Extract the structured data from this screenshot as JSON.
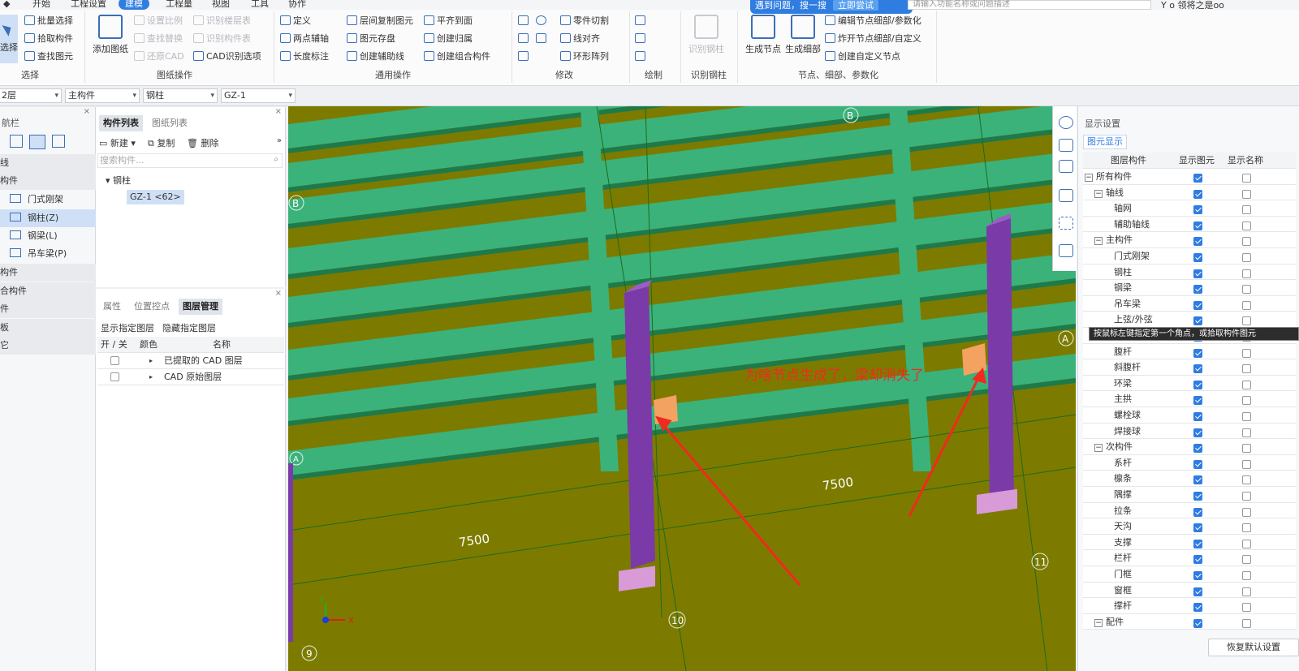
{
  "menu": {
    "tabs": [
      "开始",
      "工程设置",
      "建模",
      "工程量",
      "视图",
      "工具",
      "协作"
    ],
    "active_tab": "建模"
  },
  "notice": {
    "text": "遇到问题，搜一搜",
    "try_label": "立即尝试"
  },
  "search": {
    "placeholder": "请输入功能名称或问题描述"
  },
  "user": {
    "label": "Y o 领将之是oo"
  },
  "ribbon": {
    "select_group": {
      "select_label": "选择",
      "batch_select": "批量选择",
      "pick_component": "拾取构件",
      "find_element": "查找图元",
      "group_label": "选择"
    },
    "drawing_group": {
      "add_drawing": "添加图纸",
      "set_scale": "设置比例",
      "find_replace": "查找替换",
      "restore_cad": "还原CAD",
      "identify_floor_table": "识别楼层表",
      "identify_component_table": "识别构件表",
      "cad_options": "CAD识别选项",
      "group_label": "图纸操作"
    },
    "general_group": {
      "define": "定义",
      "copy_between_floors": "层间复制图元",
      "align_to_surface": "平齐到面",
      "two_point_axis": "两点辅轴",
      "save_element": "图元存盘",
      "create_group": "创建归属",
      "length_dim": "长度标注",
      "create_aux_line": "创建辅助线",
      "create_combo": "创建组合构件",
      "group_label": "通用操作"
    },
    "modify_group": {
      "part_cut": "零件切割",
      "line_align": "线对齐",
      "ring_array": "环形阵列",
      "group_label": "修改"
    },
    "draw_group": {
      "group_label": "绘制"
    },
    "steel_group": {
      "identify_steel_column": "识别钢柱",
      "group_label": "识别钢柱"
    },
    "node_group": {
      "generate_node": "生成节点",
      "generate_detail": "生成细部",
      "edit_node_detail": "编辑节点细部/参数化",
      "explode_node": "炸开节点细部/自定义",
      "create_custom_node": "创建自定义节点",
      "group_label": "节点、细部、参数化"
    }
  },
  "combos": {
    "floor": "2层",
    "type": "主构件",
    "subtype": "钢柱",
    "component": "GZ-1"
  },
  "leftnav": {
    "title": "航栏",
    "items": [
      {
        "label": "线",
        "kind": "cat"
      },
      {
        "label": "构件",
        "kind": "cat"
      },
      {
        "label": "门式刚架",
        "kind": "item"
      },
      {
        "label": "钢柱(Z)",
        "kind": "sel"
      },
      {
        "label": "钢梁(L)",
        "kind": "item"
      },
      {
        "label": "吊车梁(P)",
        "kind": "item"
      },
      {
        "label": "构件",
        "kind": "cat"
      },
      {
        "label": "合构件",
        "kind": "cat"
      },
      {
        "label": "件",
        "kind": "cat"
      },
      {
        "label": "板",
        "kind": "cat"
      },
      {
        "label": "它",
        "kind": "cat"
      }
    ]
  },
  "complist": {
    "tab_components": "构件列表",
    "tab_drawings": "图纸列表",
    "new_label": "新建",
    "copy_label": "复制",
    "delete_label": "删除",
    "search_placeholder": "搜索构件...",
    "tree_root": "钢柱",
    "tree_item": "GZ-1 <62>"
  },
  "layermgr": {
    "tab_props": "属性",
    "tab_ctrl": "位置控点",
    "tab_layers": "图层管理",
    "show_layer": "显示指定图层",
    "hide_layer": "隐藏指定图层",
    "col_onoff": "开 / 关",
    "col_color": "颜色",
    "col_name": "名称",
    "rows": [
      {
        "name": "已提取的 CAD 图层",
        "on": false
      },
      {
        "name": "CAD 原始图层",
        "on": false
      }
    ]
  },
  "viewport": {
    "annotation": "为啥节点生成了，梁却消失了",
    "dim_left": "7500",
    "dim_right": "7500",
    "axis_labels": {
      "b_top": "B",
      "b_left": "B",
      "a_right": "A",
      "a_left": "A",
      "n9": "9",
      "n10": "10",
      "n11": "11"
    },
    "axis_x": "X",
    "axis_y": "Y",
    "colors": {
      "ground": "#7c7b00",
      "beam": "#3bb27a",
      "column": "#7a3aa8",
      "node": "#f4a261",
      "arrow": "#f02a1e"
    }
  },
  "rightpanel": {
    "title": "显示设置",
    "tab": "图元显示",
    "col_layer": "图层构件",
    "col_show_elem": "显示图元",
    "col_show_name": "显示名称",
    "rows": [
      {
        "name": "所有构件",
        "level": 0,
        "exp": true,
        "e": true,
        "n": false
      },
      {
        "name": "轴线",
        "level": 1,
        "exp": true,
        "e": true,
        "n": false
      },
      {
        "name": "轴网",
        "level": 2,
        "exp": false,
        "e": true,
        "n": false
      },
      {
        "name": "辅助轴线",
        "level": 2,
        "exp": false,
        "e": true,
        "n": false
      },
      {
        "name": "主构件",
        "level": 1,
        "exp": true,
        "e": true,
        "n": false
      },
      {
        "name": "门式刚架",
        "level": 2,
        "exp": false,
        "e": true,
        "n": false
      },
      {
        "name": "钢柱",
        "level": 2,
        "exp": false,
        "e": true,
        "n": false
      },
      {
        "name": "钢梁",
        "level": 2,
        "exp": false,
        "e": true,
        "n": false
      },
      {
        "name": "吊车梁",
        "level": 2,
        "exp": false,
        "e": true,
        "n": false
      },
      {
        "name": "上弦/外弦",
        "level": 2,
        "exp": false,
        "e": true,
        "n": false
      },
      {
        "name": "",
        "level": 2,
        "exp": false,
        "e": true,
        "n": false
      },
      {
        "name": "腹杆",
        "level": 2,
        "exp": false,
        "e": true,
        "n": false
      },
      {
        "name": "斜腹杆",
        "level": 2,
        "exp": false,
        "e": true,
        "n": false
      },
      {
        "name": "环梁",
        "level": 2,
        "exp": false,
        "e": true,
        "n": false
      },
      {
        "name": "主拱",
        "level": 2,
        "exp": false,
        "e": true,
        "n": false
      },
      {
        "name": "螺栓球",
        "level": 2,
        "exp": false,
        "e": true,
        "n": false
      },
      {
        "name": "焊接球",
        "level": 2,
        "exp": false,
        "e": true,
        "n": false
      },
      {
        "name": "次构件",
        "level": 1,
        "exp": true,
        "e": true,
        "n": false
      },
      {
        "name": "系杆",
        "level": 2,
        "exp": false,
        "e": true,
        "n": false
      },
      {
        "name": "檩条",
        "level": 2,
        "exp": false,
        "e": true,
        "n": false
      },
      {
        "name": "隅撑",
        "level": 2,
        "exp": false,
        "e": true,
        "n": false
      },
      {
        "name": "拉条",
        "level": 2,
        "exp": false,
        "e": true,
        "n": false
      },
      {
        "name": "天沟",
        "level": 2,
        "exp": false,
        "e": true,
        "n": false
      },
      {
        "name": "支撑",
        "level": 2,
        "exp": false,
        "e": true,
        "n": false
      },
      {
        "name": "栏杆",
        "level": 2,
        "exp": false,
        "e": true,
        "n": false
      },
      {
        "name": "门框",
        "level": 2,
        "exp": false,
        "e": true,
        "n": false
      },
      {
        "name": "窗框",
        "level": 2,
        "exp": false,
        "e": true,
        "n": false
      },
      {
        "name": "撑杆",
        "level": 2,
        "exp": false,
        "e": true,
        "n": false
      },
      {
        "name": "配件",
        "level": 1,
        "exp": true,
        "e": true,
        "n": false
      }
    ],
    "tooltip": "按鼠标左键指定第一个角点，或拾取构件图元",
    "restore_label": "恢复默认设置"
  }
}
